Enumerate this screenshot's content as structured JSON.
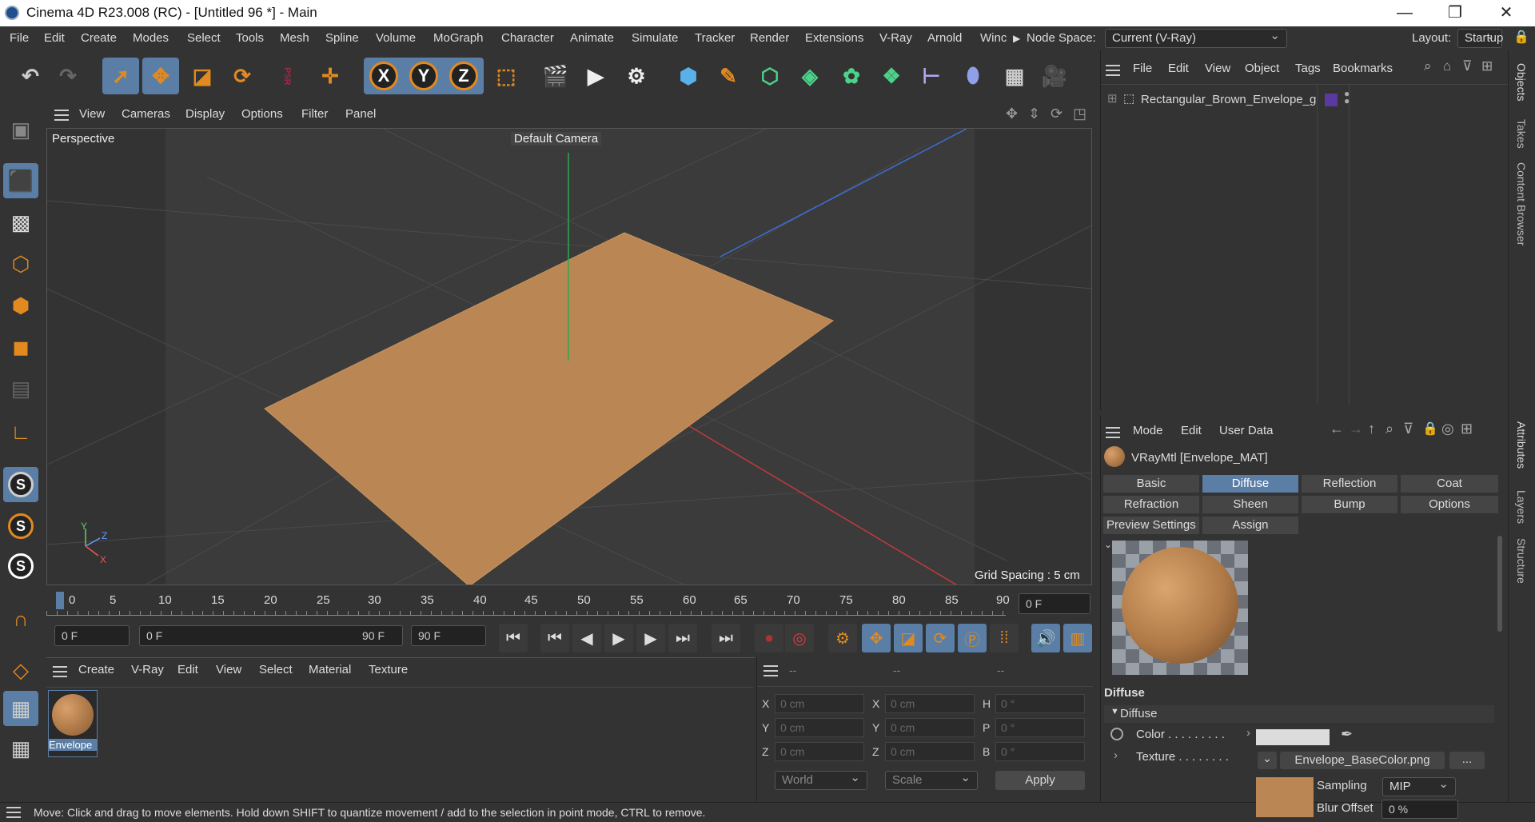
{
  "window": {
    "title": "Cinema 4D R23.008 (RC) - [Untitled 96 *] - Main",
    "minimize": "—",
    "maximize": "❐",
    "close": "✕"
  },
  "menu": {
    "items": [
      "File",
      "Edit",
      "Create",
      "Modes",
      "Select",
      "Tools",
      "Mesh",
      "Spline",
      "Volume",
      "MoGraph",
      "Character",
      "Animate",
      "Simulate",
      "Tracker",
      "Render",
      "Extensions",
      "V-Ray",
      "Arnold",
      "Winc"
    ],
    "node_space_label": "Node Space:",
    "node_space_value": "Current (V-Ray)",
    "layout_label": "Layout:",
    "layout_value": "Startup"
  },
  "toolbar": {
    "axis_x": "X",
    "axis_y": "Y",
    "axis_z": "Z",
    "psr": "PSR"
  },
  "viewport": {
    "menu": [
      "View",
      "Cameras",
      "Display",
      "Options",
      "Filter",
      "Panel"
    ],
    "label": "Perspective",
    "camera": "Default Camera",
    "grid_spacing": "Grid Spacing : 5 cm",
    "axis_x": "X",
    "axis_y": "Y",
    "axis_z": "Z",
    "floor_color": "#b98654"
  },
  "timeline": {
    "ticks": [
      "0",
      "5",
      "10",
      "15",
      "20",
      "25",
      "30",
      "35",
      "40",
      "45",
      "50",
      "55",
      "60",
      "65",
      "70",
      "75",
      "80",
      "85",
      "90"
    ],
    "current": "0 F"
  },
  "transport": {
    "start": "0 F",
    "range_start": "0 F",
    "range_end": "90 F",
    "end": "90 F"
  },
  "material_manager": {
    "menu": [
      "Create",
      "V-Ray",
      "Edit",
      "View",
      "Select",
      "Material",
      "Texture"
    ],
    "material_name": "Envelope"
  },
  "coordinates": {
    "headers": [
      "--",
      "--",
      "--"
    ],
    "rows": [
      {
        "l1": "X",
        "v1": "0 cm",
        "l2": "X",
        "v2": "0 cm",
        "l3": "H",
        "v3": "0 °"
      },
      {
        "l1": "Y",
        "v1": "0 cm",
        "l2": "Y",
        "v2": "0 cm",
        "l3": "P",
        "v3": "0 °"
      },
      {
        "l1": "Z",
        "v1": "0 cm",
        "l2": "Z",
        "v2": "0 cm",
        "l3": "B",
        "v3": "0 °"
      }
    ],
    "mode": "World",
    "scale": "Scale",
    "apply": "Apply"
  },
  "status": "Move: Click and drag to move elements. Hold down SHIFT to quantize movement / add to the selection in point mode, CTRL to remove.",
  "objects": {
    "menu": [
      "File",
      "Edit",
      "View",
      "Object",
      "Tags",
      "Bookmarks"
    ],
    "item": "Rectangular_Brown_Envelope_g"
  },
  "attributes": {
    "menu": [
      "Mode",
      "Edit",
      "User Data"
    ],
    "material": "VRayMtl [Envelope_MAT]",
    "tabs_row1": [
      "Basic",
      "Diffuse",
      "Reflection",
      "Coat"
    ],
    "tabs_row2": [
      "Refraction",
      "Sheen",
      "Bump",
      "Options"
    ],
    "tabs_row3": [
      "Preview Settings",
      "Assign"
    ],
    "section": "Diffuse",
    "group": "Diffuse",
    "color_label": "Color . . . . . . . . .",
    "texture_label": "Texture . . . . . . . .",
    "texture_file": "Envelope_BaseColor.png",
    "texture_more": "...",
    "sampling_label": "Sampling",
    "sampling_value": "MIP",
    "blur_label": "Blur Offset",
    "blur_value": "0 %",
    "swatch_color": "#dcdcdc"
  },
  "right_tabs": [
    "Objects",
    "Takes",
    "Content Browser",
    "Attributes",
    "Layers",
    "Structure"
  ]
}
